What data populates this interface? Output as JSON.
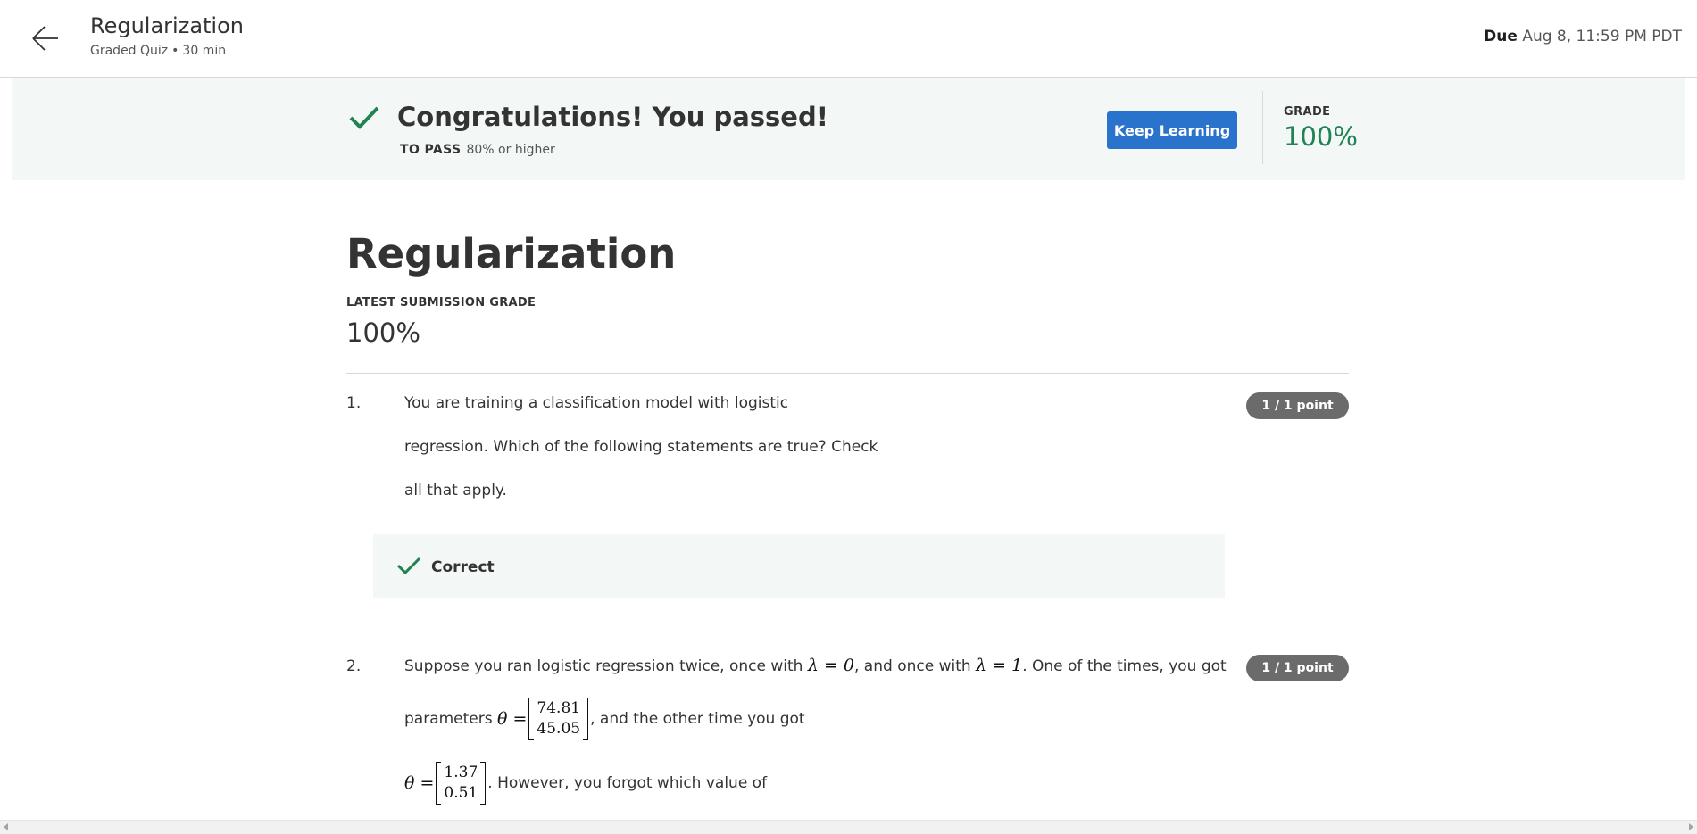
{
  "header": {
    "title": "Regularization",
    "subtitle_type": "Graded Quiz",
    "subtitle_sep": "•",
    "subtitle_time": "30 min",
    "due_label": "Due",
    "due_value": "Aug 8, 11:59 PM PDT",
    "back_icon": "arrow-left-icon"
  },
  "banner": {
    "title": "Congratulations! You passed!",
    "pass_label": "TO PASS",
    "pass_value": "80% or higher",
    "keep_learning": "Keep Learning",
    "grade_label": "GRADE",
    "grade_value": "100%",
    "accent_color": "#1f8354",
    "button_color": "#2a73cc"
  },
  "main": {
    "title": "Regularization",
    "latest_label": "LATEST SUBMISSION GRADE",
    "latest_value": "100%"
  },
  "questions": [
    {
      "number": "1.",
      "lines": [
        "You are training a classification model with logistic",
        "regression. Which of the following statements are true? Check",
        "all that apply."
      ],
      "points": "1 / 1 point",
      "feedback": "Correct"
    },
    {
      "number": "2.",
      "line1_a": "Suppose you ran logistic regression twice, once with",
      "line1_math1": "λ = 0",
      "line1_b": ", and once with",
      "line1_math2": "λ = 1",
      "line1_c": ".  One of the times, you got",
      "line2_a": "parameters",
      "theta_eq": "θ =",
      "theta1": [
        "74.81",
        "45.05"
      ],
      "line2_b": ", and the other time you got",
      "theta2": [
        "1.37",
        "0.51"
      ],
      "line3_b": ".  However, you forgot which value of",
      "points": "1 / 1 point"
    }
  ]
}
